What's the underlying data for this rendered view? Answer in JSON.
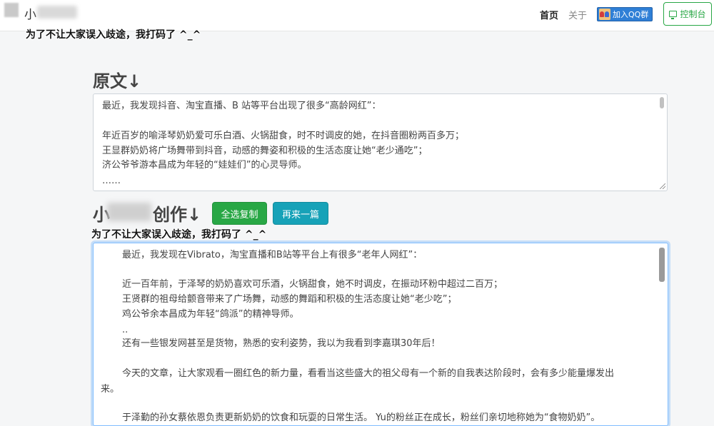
{
  "header": {
    "brand": "小",
    "nav_home": "首页",
    "nav_about": "关于",
    "qq_label": "加入QQ群",
    "console_label": "控制台"
  },
  "notice": "为了不让大家误入歧途，我打码了 ^_^",
  "original": {
    "title": "原文↓",
    "lines": [
      "最近，我发现抖音、淘宝直播、B 站等平台出现了很多“高龄网红”：",
      "",
      "年近百岁的喻泽琴奶奶爱可乐白酒、火锅甜食，时不时调皮的她，在抖音圈粉两百多万；",
      "王显群奶奶将广场舞带到抖音，动感的舞姿和积极的生活态度让她“老少通吃”；",
      "济公爷爷游本昌成为年轻的“娃娃们”的心灵导师。",
      "……"
    ]
  },
  "creation": {
    "title_prefix": "小",
    "title_suffix": "创作↓",
    "copy_button": "全选复制",
    "another_button": "再来一篇",
    "lines": [
      "最近，我发现在Vibrato，淘宝直播和B站等平台上有很多“老年人网红”：",
      "",
      "近一百年前，于泽琴的奶奶喜欢可乐酒，火锅甜食，她不时调皮，在振动环粉中超过二百万；",
      "王贤群的祖母给颤音带来了广场舞，动感的舞蹈和积极的生活态度让她“老少吃”；",
      "鸡公爷余本昌成为年轻“鸽派”的精神导师。",
      "..",
      "还有一些银发网甚至是货物，熟悉的安利姿势，我以为我看到李嘉琪30年后！",
      "",
      "今天的文章，让大家观看一圈红色的新力量，看看当这些盛大的祖父母有一个新的自我表达阶段时，会有多少能量爆发出",
      "来。",
      "",
      "于泽勤的孙女蔡依恩负责更新奶奶的饮食和玩耍的日常生活。 Yu的粉丝正在成长，粉丝们亲切地称她为“食物奶奶”。"
    ]
  }
}
